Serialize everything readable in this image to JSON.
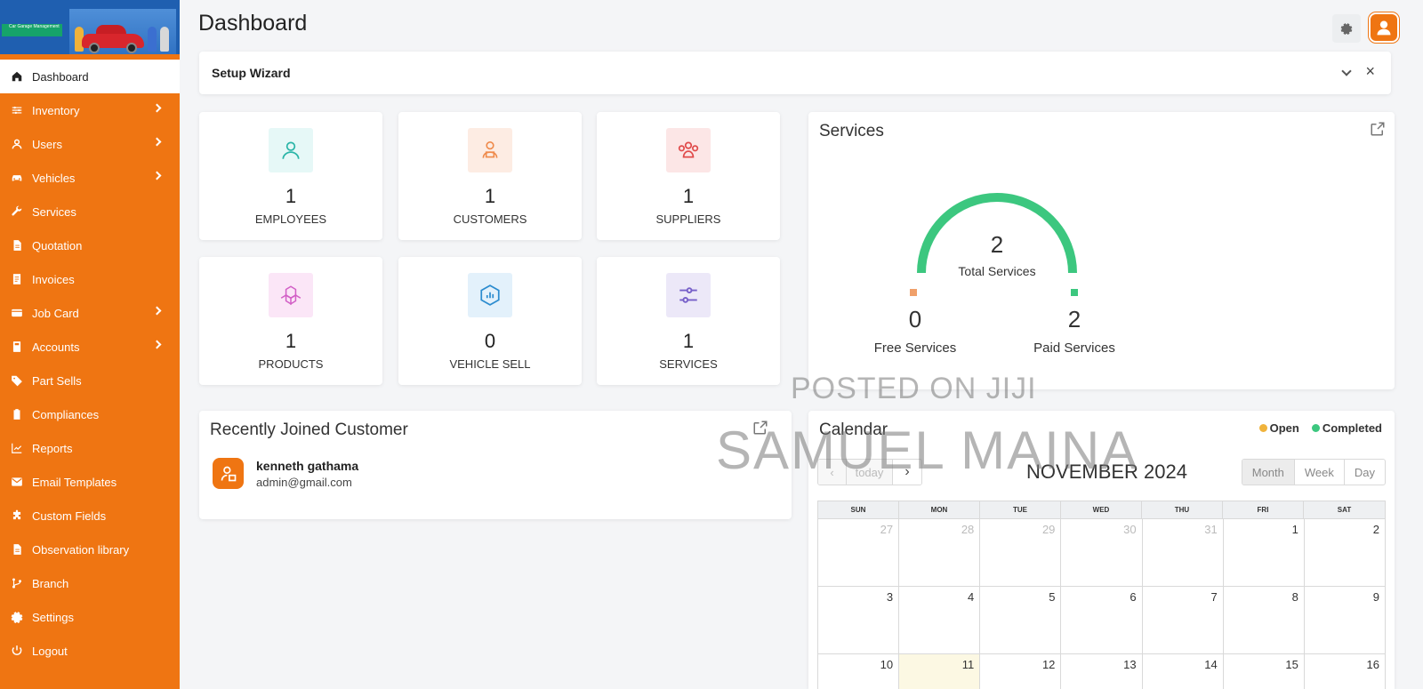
{
  "brand": {
    "logo_text": "Car Garage Management"
  },
  "sidebar": {
    "items": [
      {
        "label": "Dashboard",
        "icon": "home-icon",
        "active": true,
        "has_children": false
      },
      {
        "label": "Inventory",
        "icon": "sliders-icon",
        "has_children": true
      },
      {
        "label": "Users",
        "icon": "user-icon",
        "has_children": true
      },
      {
        "label": "Vehicles",
        "icon": "car-icon",
        "has_children": true
      },
      {
        "label": "Services",
        "icon": "wrench-icon",
        "has_children": false
      },
      {
        "label": "Quotation",
        "icon": "document-icon",
        "has_children": false
      },
      {
        "label": "Invoices",
        "icon": "invoice-icon",
        "has_children": false
      },
      {
        "label": "Job Card",
        "icon": "card-icon",
        "has_children": true
      },
      {
        "label": "Accounts",
        "icon": "calculator-icon",
        "has_children": true
      },
      {
        "label": "Part Sells",
        "icon": "tag-icon",
        "has_children": false
      },
      {
        "label": "Compliances",
        "icon": "clipboard-icon",
        "has_children": false
      },
      {
        "label": "Reports",
        "icon": "chart-icon",
        "has_children": false
      },
      {
        "label": "Email Templates",
        "icon": "email-icon",
        "has_children": false
      },
      {
        "label": "Custom Fields",
        "icon": "puzzle-icon",
        "has_children": false
      },
      {
        "label": "Observation library",
        "icon": "file-icon",
        "has_children": false
      },
      {
        "label": "Branch",
        "icon": "branch-icon",
        "has_children": false
      },
      {
        "label": "Settings",
        "icon": "gear-icon",
        "has_children": false
      },
      {
        "label": "Logout",
        "icon": "power-icon",
        "has_children": false
      }
    ]
  },
  "header": {
    "title": "Dashboard"
  },
  "wizard": {
    "title": "Setup Wizard"
  },
  "stats": [
    {
      "value": "1",
      "label": "EMPLOYEES",
      "icon": "employee-icon",
      "bg": "#e6f8f7",
      "color": "#2bb5a8"
    },
    {
      "value": "1",
      "label": "CUSTOMERS",
      "icon": "customer-icon",
      "bg": "#fdece3",
      "color": "#ef8a4b"
    },
    {
      "value": "1",
      "label": "SUPPLIERS",
      "icon": "suppliers-icon",
      "bg": "#fce6e6",
      "color": "#e04b4b"
    },
    {
      "value": "1",
      "label": "PRODUCTS",
      "icon": "products-icon",
      "bg": "#fbe6f7",
      "color": "#d25fc6"
    },
    {
      "value": "0",
      "label": "VEHICLE SELL",
      "icon": "vehicle-sell-icon",
      "bg": "#e3f1fb",
      "color": "#2c8ccf"
    },
    {
      "value": "1",
      "label": "SERVICES",
      "icon": "services-icon",
      "bg": "#ece8f8",
      "color": "#7760c9"
    }
  ],
  "services_card": {
    "title": "Services",
    "total": "2",
    "total_label": "Total Services",
    "free": "0",
    "free_label": "Free Services",
    "paid": "2",
    "paid_label": "Paid Services",
    "free_color": "#f0a06a",
    "paid_color": "#3cc77f",
    "gauge_fraction": 1.0
  },
  "recent_customer": {
    "title": "Recently Joined Customer",
    "name": "kenneth gathama",
    "email": "admin@gmail.com"
  },
  "calendar": {
    "title": "Calendar",
    "legend_open": "Open",
    "legend_completed": "Completed",
    "open_color": "#f0b33c",
    "completed_color": "#3cc77f",
    "today_btn": "today",
    "month_label": "NOVEMBER 2024",
    "views": [
      "Month",
      "Week",
      "Day"
    ],
    "weekdays": [
      "SUN",
      "MON",
      "TUE",
      "WED",
      "THU",
      "FRI",
      "SAT"
    ],
    "days": [
      {
        "d": "27",
        "muted": true
      },
      {
        "d": "28",
        "muted": true
      },
      {
        "d": "29",
        "muted": true
      },
      {
        "d": "30",
        "muted": true
      },
      {
        "d": "31",
        "muted": true
      },
      {
        "d": "1"
      },
      {
        "d": "2"
      },
      {
        "d": "3"
      },
      {
        "d": "4"
      },
      {
        "d": "5"
      },
      {
        "d": "6"
      },
      {
        "d": "7"
      },
      {
        "d": "8"
      },
      {
        "d": "9"
      },
      {
        "d": "10"
      },
      {
        "d": "11",
        "today": true
      },
      {
        "d": "12"
      },
      {
        "d": "13"
      },
      {
        "d": "14"
      },
      {
        "d": "15"
      },
      {
        "d": "16"
      }
    ]
  },
  "watermark": {
    "line1": "POSTED ON JIJI",
    "line2": "SAMUEL MAINA"
  },
  "colors": {
    "accent": "#ef7512"
  }
}
